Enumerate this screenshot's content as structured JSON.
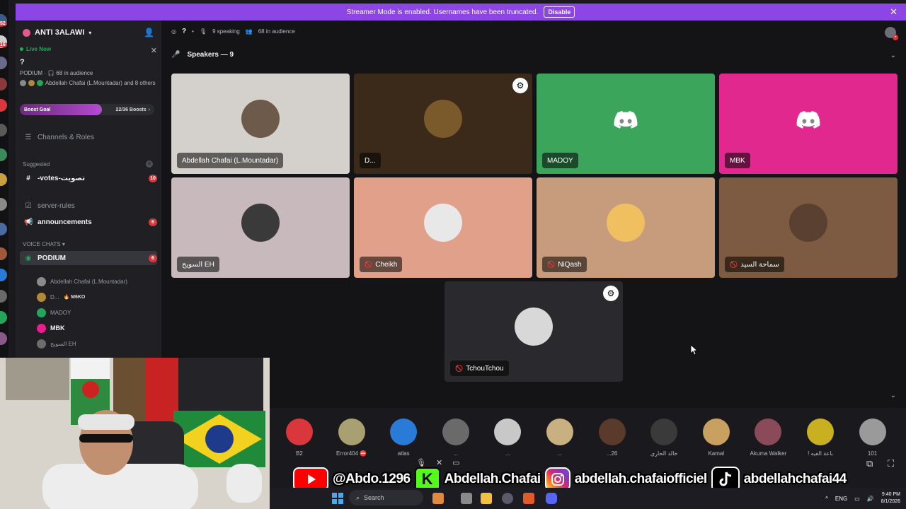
{
  "banner": {
    "text": "Streamer Mode is enabled. Usernames have been truncated.",
    "disable_label": "Disable"
  },
  "server": {
    "name": "ANTI 3ALAWI"
  },
  "live": {
    "label": "Live Now",
    "title": "?",
    "meta": "PODIUM · 🎧 68 in audience",
    "people": "Abdellah Chafai (L.Mountadar) and 8 others"
  },
  "boost": {
    "label": "Boost Goal",
    "count": "22/36 Boosts",
    "progress": 0.61
  },
  "sidebar": {
    "channels_roles": "Channels & Roles",
    "suggested_label": "Suggested",
    "votes": {
      "name": "-votes-تصويت",
      "count": "10"
    },
    "server_rules": "server-rules",
    "announcements": {
      "name": "announcements",
      "count": "6"
    },
    "voice_label": "VOICE CHATS",
    "podium": {
      "name": "PODIUM",
      "count": "6"
    },
    "voice_users": [
      {
        "name": "Abdellah Chafai (L.Mountadar)",
        "color": "#8a8a8a"
      },
      {
        "name": "D...",
        "tag": "🔥 M6KO",
        "color": "#b08a3a"
      },
      {
        "name": "MADOY",
        "color": "#23a55a"
      },
      {
        "name": "MBK",
        "color": "#e91e8c"
      },
      {
        "name": "السويح EH",
        "color": "#6d6d6d"
      }
    ]
  },
  "topbar": {
    "title": "?",
    "speaking": "9 speaking",
    "audience": "68 in audience"
  },
  "speakers_label": "Speakers — 9",
  "speakers": [
    {
      "name": "Abdellah Chafai (L.Mountadar)",
      "bg": "#d4d0cb",
      "muted": false
    },
    {
      "name": "D...",
      "bg": "#3b2a1a",
      "muted": false
    },
    {
      "name": "MADOY",
      "bg": "#3ba55c",
      "muted": false
    },
    {
      "name": "MBK",
      "bg": "#e0288e",
      "muted": false
    },
    {
      "name": "السويح EH",
      "bg": "#c8b9bc",
      "muted": false
    },
    {
      "name": "Cheikh",
      "bg": "#e0a08a",
      "muted": true
    },
    {
      "name": "NiQash",
      "bg": "#c79c7c",
      "muted": true
    },
    {
      "name": "سماحة السيد",
      "bg": "#7d5b42",
      "muted": true
    },
    {
      "name": "TchouTchou",
      "bg": "#2a2a2e",
      "muted": true
    }
  ],
  "audience": [
    {
      "name": "B2",
      "color": "#da373c"
    },
    {
      "name": "Error404 ⛔",
      "color": "#a8a070"
    },
    {
      "name": "atlas",
      "color": "#2a7ad8"
    },
    {
      "name": "...",
      "color": "#6a6a6a"
    },
    {
      "name": "...",
      "color": "#c8c8c8"
    },
    {
      "name": "...",
      "color": "#c8b080"
    },
    {
      "name": "...26",
      "color": "#5a3a2a"
    },
    {
      "name": "خالد الحاري",
      "color": "#3a3a3a"
    },
    {
      "name": "Kamal",
      "color": "#c8a060"
    },
    {
      "name": "Akuma Walker",
      "color": "#8a4a5a"
    },
    {
      "name": "! باعة الفيه",
      "color": "#c8b020"
    },
    {
      "name": "101",
      "color": "#9a9a9a"
    }
  ],
  "social": {
    "youtube": "@Abdo.1296",
    "kick": "Abdellah.Chafai",
    "instagram": "abdellah.chafaiofficiel",
    "tiktok": "abdellahchafai44"
  },
  "taskbar": {
    "search": "Search",
    "lang": "ENG",
    "time": "9:40 PM",
    "date": "8/1/2026"
  }
}
